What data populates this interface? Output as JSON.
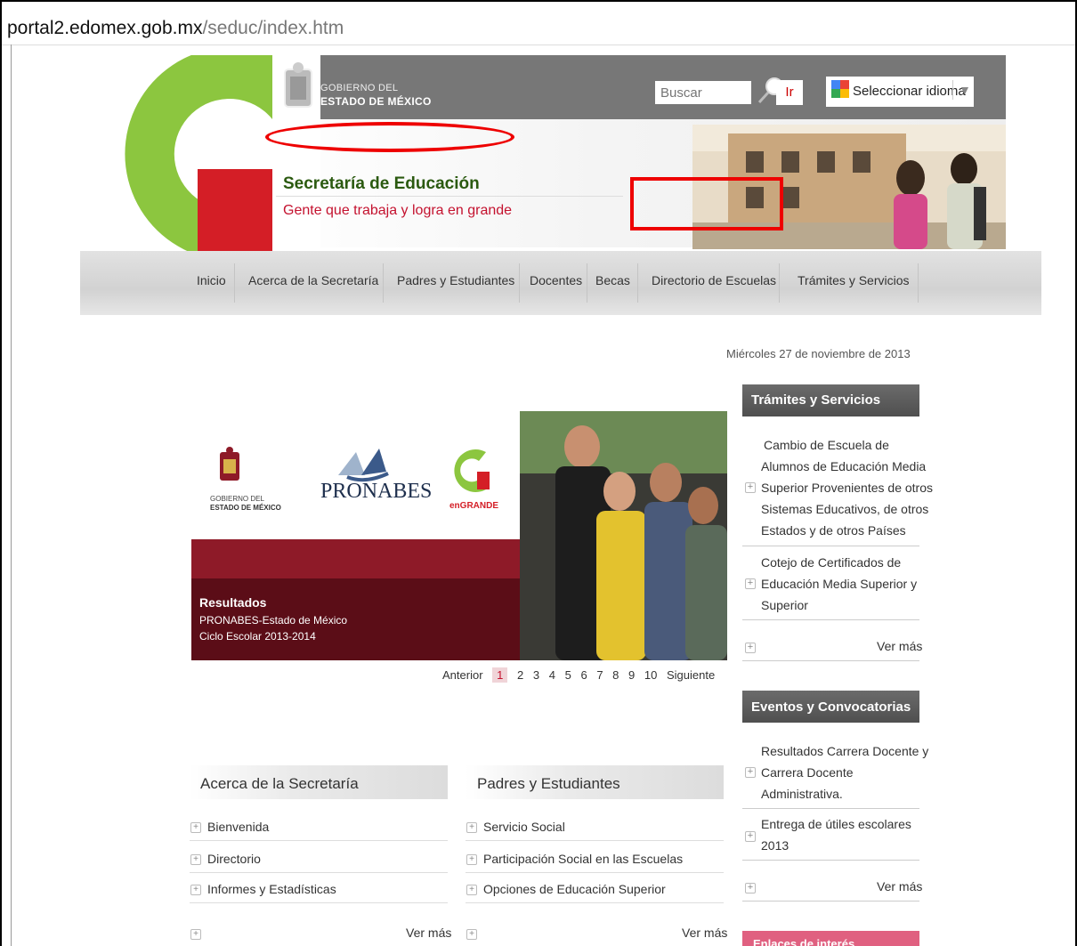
{
  "browser": {
    "url_host": "portal2.edomex.gob.mx",
    "url_path": "/seduc/index.htm"
  },
  "header": {
    "gov_line1": "GOBIERNO DEL",
    "gov_line2": "ESTADO DE MÉXICO",
    "search_placeholder": "Buscar",
    "search_button": "Ir",
    "language_label": "Seleccionar idioma",
    "language_arrow": "▼",
    "title": "Secretaría de Educación",
    "slogan": "Gente que trabaja y logra en grande"
  },
  "nav": [
    "Inicio",
    "Acerca de la Secretaría",
    "Padres y Estudiantes",
    "Docentes",
    "Becas",
    "Directorio de Escuelas",
    "Trámites y Servicios"
  ],
  "date": "Miércoles 27 de noviembre de 2013",
  "slider": {
    "logo1_line1": "GOBIERNO DEL",
    "logo1_line2": "ESTADO DE MÉXICO",
    "logo2": "PRONABES",
    "logo3": "enGRANDE",
    "caption_title": "Resultados",
    "caption_line1": "PRONABES-Estado de México",
    "caption_line2": "Ciclo Escolar 2013-2014",
    "pager_prev": "Anterior",
    "pager_pages": [
      "1",
      "2",
      "3",
      "4",
      "5",
      "6",
      "7",
      "8",
      "9",
      "10"
    ],
    "pager_next": "Siguiente"
  },
  "tramites": {
    "title": "Trámites y Servicios",
    "item1": [
      "Cambio de Escuela de",
      "Alumnos de Educación Media",
      "Superior Provenientes de otros",
      "Sistemas Educativos, de otros",
      "Estados y de otros Países"
    ],
    "item2": [
      "Cotejo de Certificados de",
      "Educación Media Superior y",
      "Superior"
    ],
    "more": "Ver más"
  },
  "eventos": {
    "title": "Eventos y Convocatorias",
    "item1": [
      "Resultados Carrera Docente y",
      "Carrera Docente",
      "Administrativa."
    ],
    "item2": [
      "Entrega de útiles escolares",
      "2013"
    ],
    "more": "Ver más"
  },
  "enlaces": {
    "title": "Enlaces de interés"
  },
  "acerca": {
    "title": "Acerca de la Secretaría",
    "items": [
      "Bienvenida",
      "Directorio",
      "Informes y Estadísticas"
    ],
    "more": "Ver más"
  },
  "padres": {
    "title": "Padres y Estudiantes",
    "items": [
      "Servicio Social",
      "Participación Social en las Escuelas",
      "Opciones de Educación Superior"
    ],
    "more": "Ver más"
  },
  "colors": {
    "brand_green": "#8cc63f",
    "brand_red": "#d41e26",
    "dark_green_text": "#2b5a10",
    "slider_maroon": "#8e1a28"
  }
}
